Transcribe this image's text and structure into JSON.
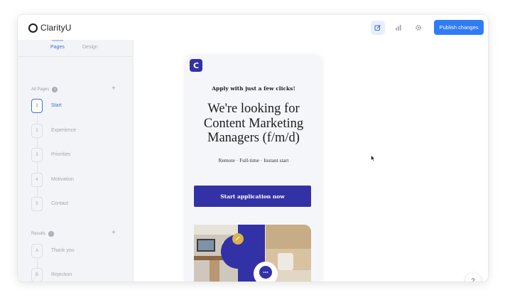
{
  "app": {
    "name": "ClarityU"
  },
  "toolbar": {
    "icons": [
      "edit-icon",
      "analytics-icon",
      "settings-icon"
    ],
    "publish_label": "Publish changes",
    "accent_color": "#2f7cf6"
  },
  "sidebar": {
    "tabs": [
      {
        "label": "Pages",
        "active": true
      },
      {
        "label": "Design",
        "active": false
      }
    ],
    "all_pages": {
      "title": "All Pages",
      "items": [
        {
          "num": "1",
          "label": "Start",
          "selected": true
        },
        {
          "num": "2",
          "label": "Experience",
          "selected": false
        },
        {
          "num": "3",
          "label": "Priorities",
          "selected": false
        },
        {
          "num": "4",
          "label": "Motivation",
          "selected": false
        },
        {
          "num": "5",
          "label": "Contact",
          "selected": false
        }
      ]
    },
    "results": {
      "title": "Results",
      "items": [
        {
          "num": "A",
          "label": "Thank you"
        },
        {
          "num": "B",
          "label": "Rejection"
        }
      ]
    }
  },
  "preview": {
    "logo_letter": "C",
    "subheading": "Apply with just a few clicks!",
    "headline": "We're looking for Content Marketing Managers (f/m/d)",
    "meta": "Remote · Full-time · Instant start",
    "cta_label": "Start application now",
    "brand_color": "#3232a6"
  },
  "help": {
    "label": "?"
  }
}
